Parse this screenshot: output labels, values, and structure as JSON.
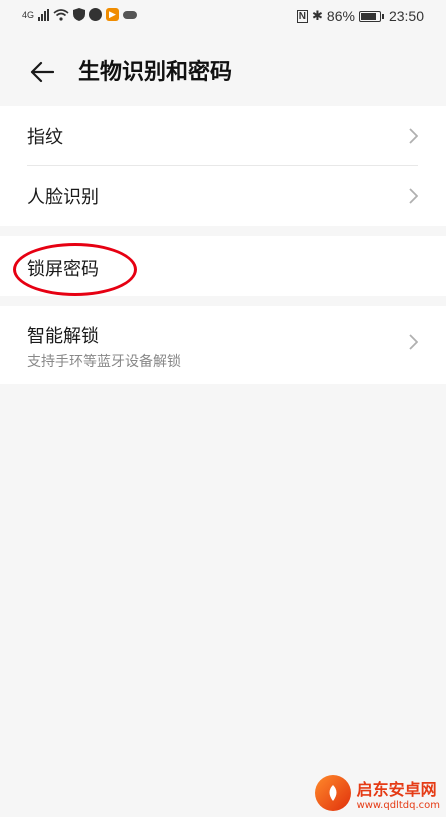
{
  "status_bar": {
    "network": "4G",
    "battery": "86%",
    "battery_level": 0.86,
    "time": "23:50",
    "nfc": "N"
  },
  "header": {
    "title": "生物识别和密码"
  },
  "menu": {
    "fingerprint": "指纹",
    "face": "人脸识别",
    "lock_screen_password": "锁屏密码",
    "smart_unlock": "智能解锁",
    "smart_unlock_desc": "支持手环等蓝牙设备解锁"
  },
  "watermark": {
    "name": "启东安卓网",
    "url": "www.qdltdq.com"
  },
  "colors": {
    "highlight": "#e60012",
    "background": "#f6f6f6",
    "card": "#ffffff"
  }
}
